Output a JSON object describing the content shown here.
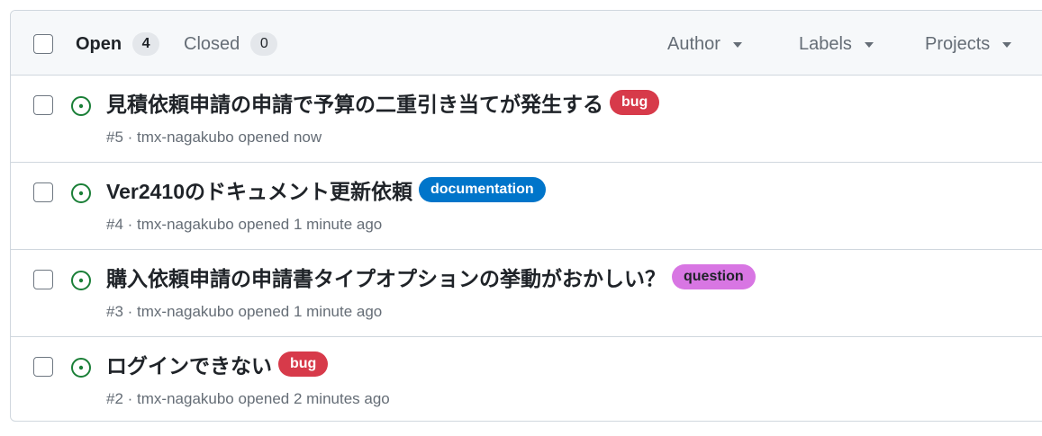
{
  "header": {
    "open_label": "Open",
    "open_count": "4",
    "closed_label": "Closed",
    "closed_count": "0",
    "filters": {
      "author": "Author",
      "labels": "Labels",
      "projects": "Projects"
    }
  },
  "issues": [
    {
      "title": "見積依頼申請の申請で予算の二重引き当てが発生する",
      "label": "bug",
      "label_bg": "#d73a4a",
      "label_fg": "#ffffff",
      "number": "#5",
      "author": "tmx-nagakubo",
      "opened": "opened now"
    },
    {
      "title": "Ver2410のドキュメント更新依頼",
      "label": "documentation",
      "label_bg": "#0075ca",
      "label_fg": "#ffffff",
      "number": "#4",
      "author": "tmx-nagakubo",
      "opened": "opened 1 minute ago"
    },
    {
      "title": "購入依頼申請の申請書タイプオプションの挙動がおかしい？",
      "label": "question",
      "label_bg": "#d876e3",
      "label_fg": "#1f2328",
      "number": "#3",
      "author": "tmx-nagakubo",
      "opened": "opened 1 minute ago"
    },
    {
      "title": "ログインできない",
      "label": "bug",
      "label_bg": "#d73a4a",
      "label_fg": "#ffffff",
      "number": "#2",
      "author": "tmx-nagakubo",
      "opened": "opened 2 minutes ago"
    }
  ],
  "colors": {
    "open_icon": "#1a7f37"
  }
}
